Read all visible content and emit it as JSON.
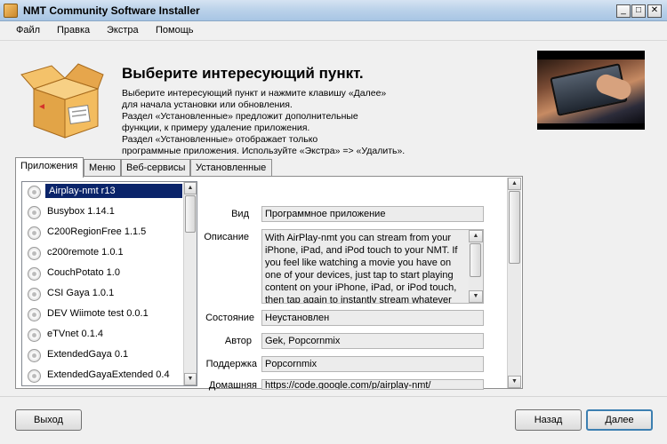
{
  "window": {
    "title": "NMT Community Software Installer",
    "min": "_",
    "max": "□",
    "close": "✕"
  },
  "menu": [
    {
      "label": "Файл"
    },
    {
      "label": "Правка"
    },
    {
      "label": "Экстра"
    },
    {
      "label": "Помощь"
    }
  ],
  "header": {
    "heading": "Выберите интересующий пункт.",
    "description": "Выберите интересующий пункт и нажмите клавишу «Далее»\nдля начала установки или обновления.\nРаздел «Установленные» предложит дополнительные\nфункции, к примеру удаление приложения.\nРаздел «Установленные» отображает только\nпрограммные приложения. Используйте «Экстра» => «Удалить»."
  },
  "tabs": [
    {
      "label": "Приложения",
      "active": true
    },
    {
      "label": "Меню"
    },
    {
      "label": "Веб-сервисы"
    },
    {
      "label": "Установленные"
    }
  ],
  "apps": [
    {
      "label": "Airplay-nmt r13",
      "selected": true
    },
    {
      "label": "Busybox 1.14.1"
    },
    {
      "label": "C200RegionFree 1.1.5"
    },
    {
      "label": "c200remote 1.0.1"
    },
    {
      "label": "CouchPotato 1.0"
    },
    {
      "label": "CSI Gaya 1.0.1"
    },
    {
      "label": "DEV Wiimote test 0.0.1"
    },
    {
      "label": "eTVnet 0.1.4"
    },
    {
      "label": "ExtendedGaya 0.1"
    },
    {
      "label": "ExtendedGayaExtended 0.4"
    }
  ],
  "details": {
    "type_label": "Вид",
    "type_value": "Программное приложение",
    "desc_label": "Описание",
    "desc_value": "With AirPlay-nmt you can stream from your iPhone, iPad, and iPod touch to your NMT. If you feel like watching a movie you have on one of your devices, just tap to start playing content on your iPhone, iPad, or iPod touch, then tap again to instantly stream whatever you're",
    "status_label": "Состояние",
    "status_value": "Неустановлен",
    "author_label": "Автор",
    "author_value": "Gek, Popcornmix",
    "support_label": "Поддержка",
    "support_value": "Popcornmix",
    "home_label": "Домашняя",
    "home_value": "https://code.google.com/p/airplay-nmt/"
  },
  "buttons": {
    "exit": "Выход",
    "back": "Назад",
    "next": "Далее"
  }
}
